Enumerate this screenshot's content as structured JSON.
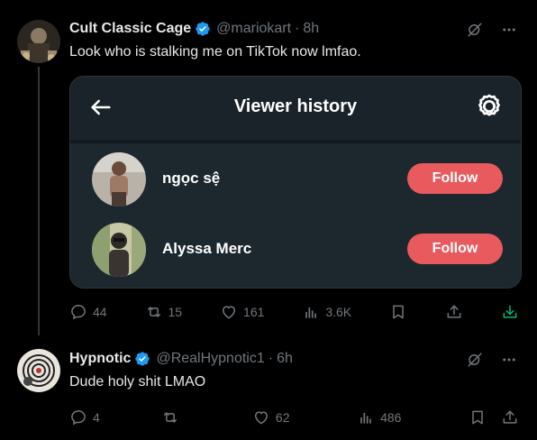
{
  "tweet1": {
    "display_name": "Cult Classic Cage",
    "handle": "@mariokart",
    "dot": "·",
    "time": "8h",
    "text": "Look who is stalking me on TikTok now lmfao.",
    "embed": {
      "title": "Viewer history",
      "viewers": [
        {
          "name": "ngọc sệ",
          "button": "Follow"
        },
        {
          "name": "Alyssa Merc",
          "button": "Follow"
        }
      ]
    },
    "actions": {
      "replies": "44",
      "reposts": "15",
      "likes": "161",
      "views": "3.6K"
    }
  },
  "tweet2": {
    "display_name": "Hypnotic",
    "handle": "@RealHypnotic1",
    "dot": "·",
    "time": "6h",
    "text": "Dude holy shit LMAO",
    "actions": {
      "replies": "4",
      "reposts": "",
      "likes": "62",
      "views": "486"
    }
  },
  "colors": {
    "background": "#000000",
    "verified": "#1d9bf0",
    "follow_button": "#e85a5e",
    "muted_text": "#71767b",
    "download_accent": "#00ba7c"
  }
}
